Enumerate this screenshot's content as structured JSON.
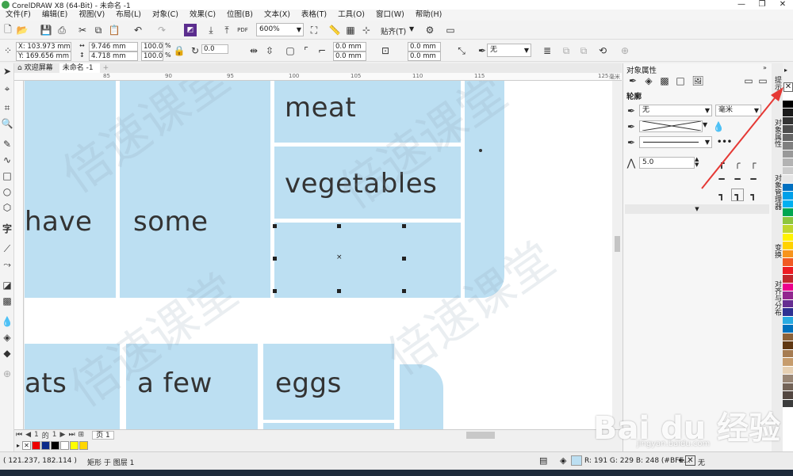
{
  "window": {
    "title": "CorelDRAW X8 (64-Bit) - 未命名 -1"
  },
  "menu": [
    "文件(F)",
    "编辑(E)",
    "视图(V)",
    "布局(L)",
    "对象(C)",
    "效果(C)",
    "位图(B)",
    "文本(X)",
    "表格(T)",
    "工具(O)",
    "窗口(W)",
    "帮助(H)"
  ],
  "toolbar": {
    "zoom": "600%",
    "snap": "贴齐(T)",
    "pdf": "PDF"
  },
  "props": {
    "x": "X: 103.973 mm",
    "y": "Y: 169.656 mm",
    "width": "9.746 mm",
    "height": "4.718 mm",
    "scale_w": "100.0",
    "scale_h": "100.0",
    "pct": "%",
    "angle": "0.0",
    "corner1": "0.0 mm",
    "corner2": "0.0 mm",
    "corner3": "0.0 mm",
    "corner4": "0.0 mm",
    "outline": "无"
  },
  "tabs": {
    "welcome": "欢迎屏幕",
    "doc": "未命名 -1"
  },
  "ruler": {
    "labels": [
      "85",
      "90",
      "95",
      "100",
      "105",
      "110",
      "115",
      "125",
      "毫米"
    ]
  },
  "canvas": {
    "words": {
      "meat": "meat",
      "vegetables": "vegetables",
      "have": "have",
      "some": "some",
      "ats": "ats",
      "afew": "a few",
      "eggs": "eggs"
    },
    "watermark": "倍速课堂"
  },
  "pagenav": {
    "current": "1",
    "of": "的",
    "total": "1",
    "page_tab": "页 1"
  },
  "status": {
    "coords": "( 121.237, 182.114 )",
    "object": "矩形 于 图层 1",
    "fill": "R: 191 G: 229 B: 248 (#BFE...",
    "outline": "无"
  },
  "docker": {
    "title": "对象属性",
    "section": "轮廓",
    "width_value": "无",
    "unit": "毫米",
    "miter": "5.0",
    "tabs": [
      "提示",
      "对象属性",
      "对象管理器",
      "变换",
      "对齐与分布"
    ]
  },
  "watermark": {
    "logo": "Bai du 经验",
    "url": "jingyan.baidu.com"
  },
  "colors": {
    "fill": "#bcdff2",
    "accent_red": "#e53935",
    "palette": [
      "#ffffff",
      "#000000",
      "#1a1a1a",
      "#333333",
      "#4d4d4d",
      "#666666",
      "#808080",
      "#999999",
      "#b3b3b3",
      "#cccccc",
      "#e6e6e6",
      "#0070c0",
      "#00a0e9",
      "#00b0f0",
      "#00a651",
      "#8dc63f",
      "#c0d62e",
      "#fff200",
      "#ffd200",
      "#f7941d",
      "#f15a24",
      "#ed1c24",
      "#c1272d",
      "#ec008c",
      "#92278f",
      "#662d91",
      "#2e3192",
      "#29abe2",
      "#0071bc",
      "#8c6239",
      "#603813",
      "#a67c52",
      "#c69c6d",
      "#e6d0b3",
      "#998675",
      "#736357",
      "#534741",
      "#3c3c3c"
    ]
  }
}
